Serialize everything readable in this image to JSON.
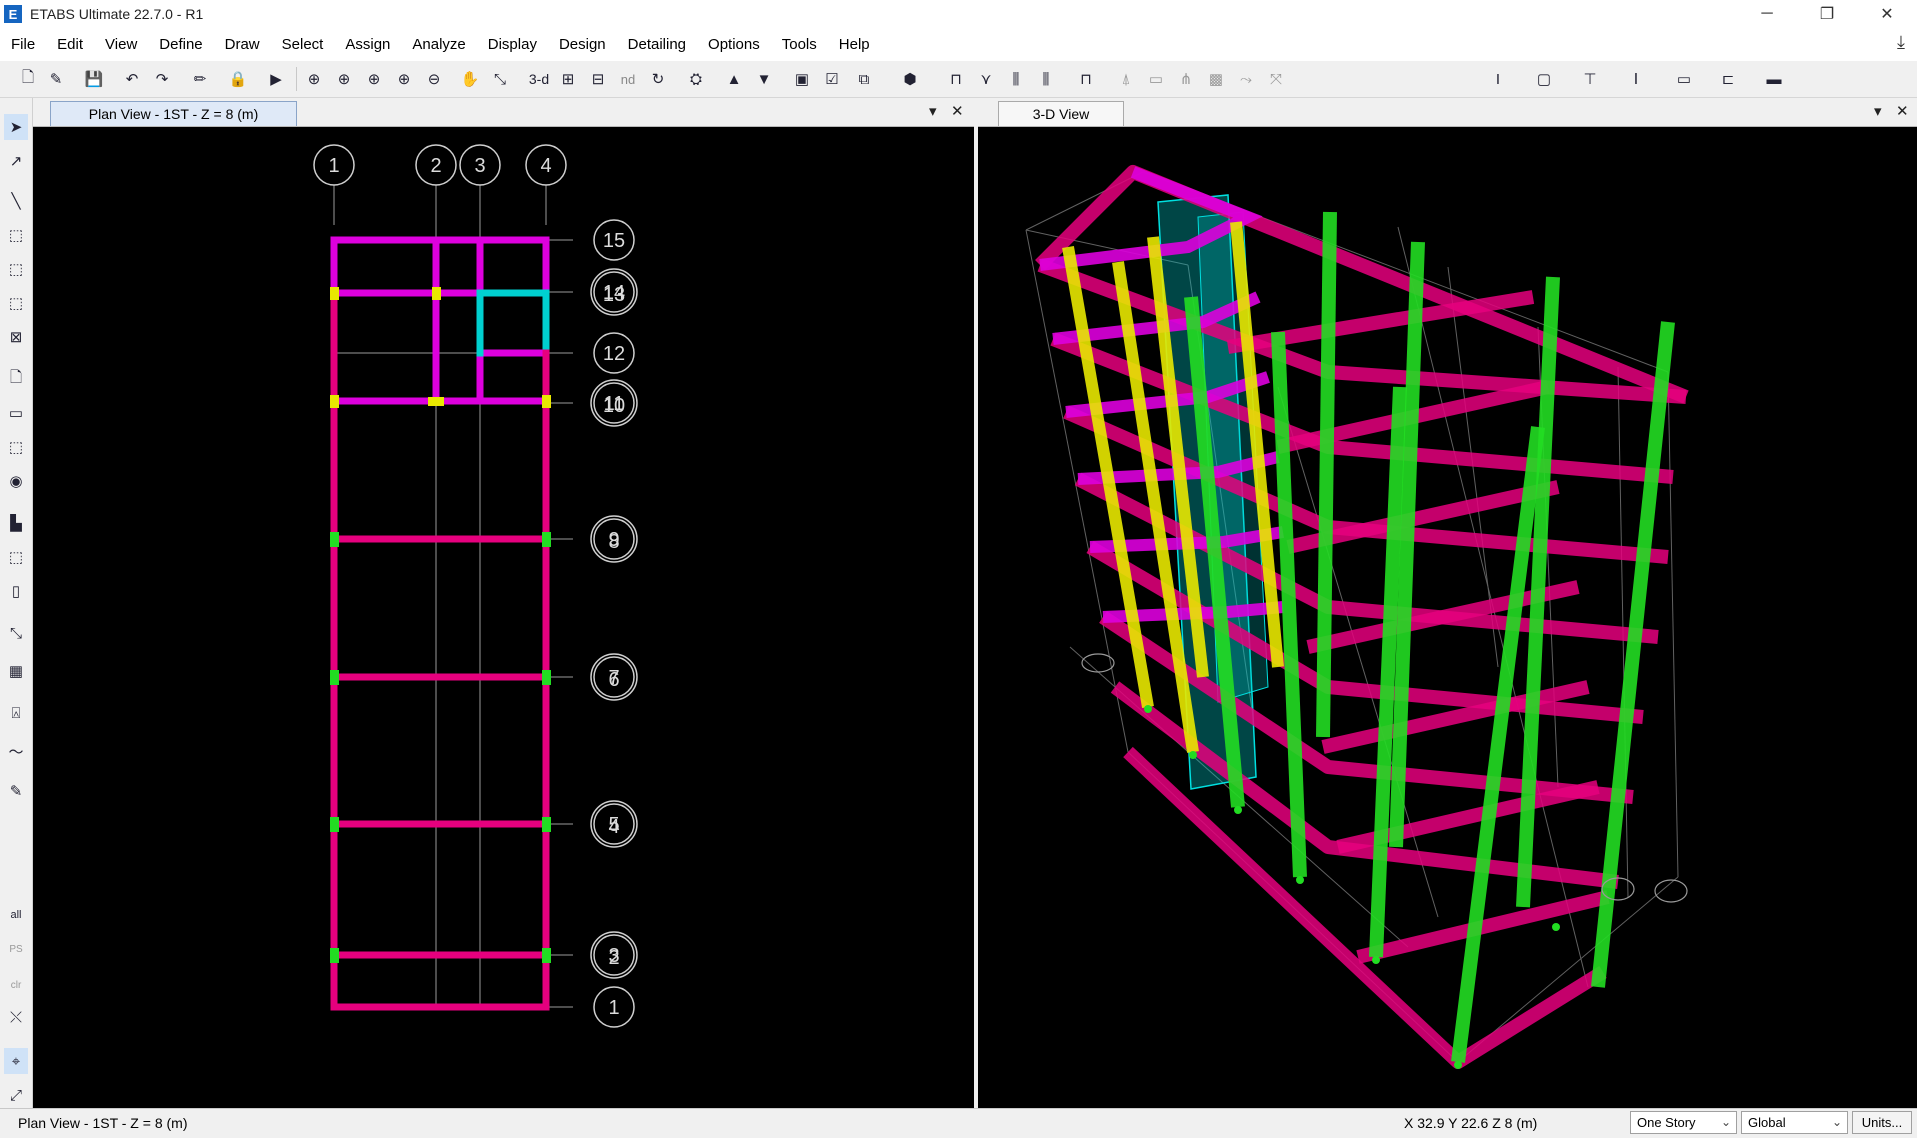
{
  "window": {
    "title": "ETABS Ultimate 22.7.0 - R1",
    "logo_letter": "E",
    "minimize": "─",
    "restore": "❐",
    "close": "✕"
  },
  "menu": [
    "File",
    "Edit",
    "View",
    "Define",
    "Draw",
    "Select",
    "Assign",
    "Analyze",
    "Display",
    "Design",
    "Detailing",
    "Options",
    "Tools",
    "Help"
  ],
  "toolbar": {
    "text_3d": "3-d",
    "text_nd": "nd"
  },
  "left_tools": {
    "label_all": "all",
    "label_ps": "PS",
    "label_clr": "clr"
  },
  "plan_view": {
    "tab_label": "Plan View - 1ST - Z = 8 (m)",
    "col_grid_labels": [
      "1",
      "2",
      "3",
      "4"
    ],
    "row_grid_labels": [
      "15",
      "14",
      "13",
      "12",
      "11",
      "10",
      "9",
      "8",
      "7",
      "6",
      "5",
      "4",
      "3",
      "2",
      "1"
    ]
  },
  "view_3d": {
    "tab_label": "3-D View"
  },
  "colors": {
    "beam": "#e6007e",
    "frame_magenta": "#dd00dd",
    "column_yellow": "#e8e800",
    "column_green": "#22dd22",
    "wall_cyan": "#00d0d0",
    "grid": "#9a9a9a"
  },
  "status": {
    "view_label": "Plan View - 1ST - Z = 8 (m)",
    "coords": "X 32.9  Y 22.6  Z 8 (m)",
    "story_option": "One Story",
    "coord_system": "Global",
    "units_button": "Units..."
  }
}
